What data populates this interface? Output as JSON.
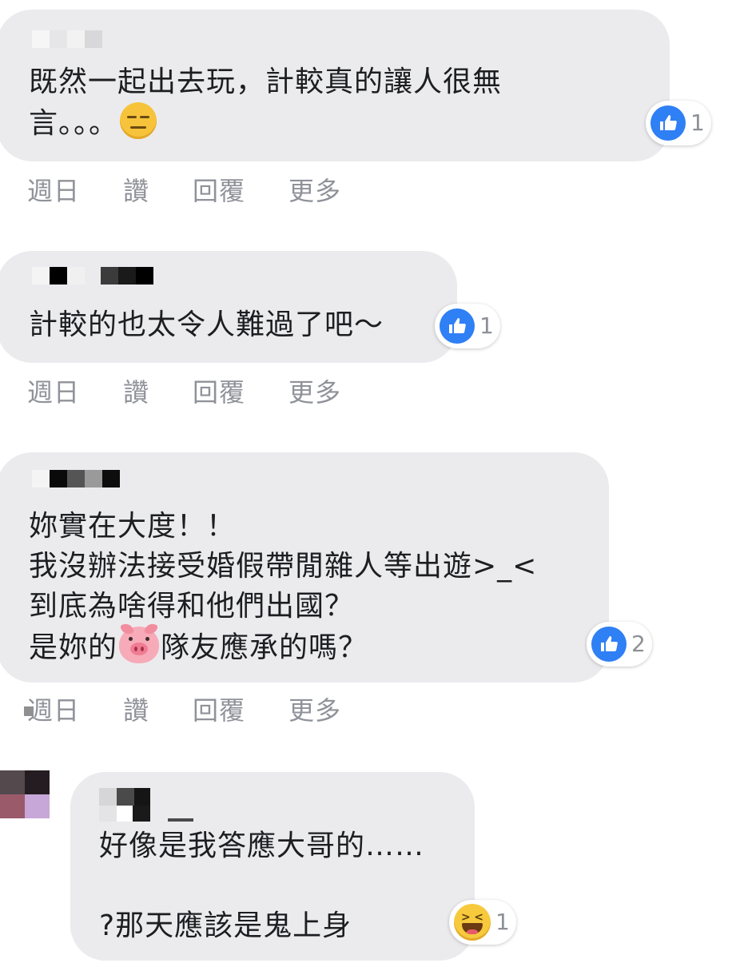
{
  "comments": [
    {
      "lines": [
        "既然一起出去玩，計較真的讓人很無",
        "言。。。"
      ],
      "reaction_type": "like",
      "reaction_count": "1"
    },
    {
      "lines": [
        "計較的也太令人難過了吧～"
      ],
      "reaction_type": "like",
      "reaction_count": "1"
    },
    {
      "lines": [
        "妳實在大度！！",
        "我沒辦法接受婚假帶閒雜人等出遊>_<",
        "到底為啥得和他們出國？",
        "是妳的",
        "隊友應承的嗎？"
      ],
      "reaction_type": "like",
      "reaction_count": "2"
    },
    {
      "lines": [
        "好像是我答應大哥的……",
        "?那天應該是鬼上身"
      ],
      "reaction_type": "haha",
      "reaction_count": "1"
    }
  ],
  "actions": {
    "time": "週日",
    "like": "讚",
    "reply": "回覆",
    "more": "更多"
  },
  "colors": {
    "bubble": "#ebebee",
    "like_blue": "#2f7ff5",
    "action_gray": "#8f9299"
  },
  "icons": [
    "expressionless-emoji-icon",
    "pig-face-emoji-icon",
    "like-icon",
    "haha-icon"
  ]
}
